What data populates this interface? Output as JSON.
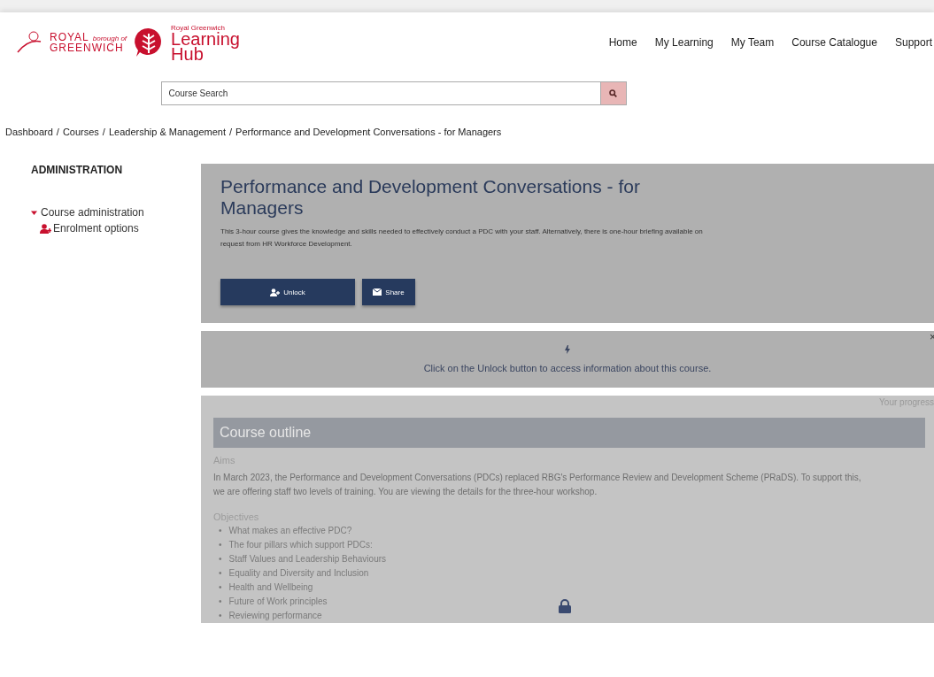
{
  "logo": {
    "council_top": "ROYAL",
    "council_small": "borough of",
    "council_bottom": "GREENWICH",
    "hub_small": "Royal Greenwich",
    "hub_top": "Learning",
    "hub_bottom": "Hub"
  },
  "nav": [
    "Home",
    "My Learning",
    "My Team",
    "Course Catalogue",
    "Support"
  ],
  "search": {
    "placeholder": "Course Search"
  },
  "breadcrumb": [
    {
      "label": "Dashboard"
    },
    {
      "separator": "/",
      "label": "Courses"
    },
    {
      "separator": "/",
      "label": "Leadership & Management"
    },
    {
      "separator": "/",
      "label": "Performance and Development Conversations - for Managers"
    }
  ],
  "sidebar": {
    "title": "ADMINISTRATION",
    "items": [
      {
        "label": "Course administration",
        "expanded": true,
        "children": [
          {
            "label": "Enrolment options"
          }
        ]
      }
    ]
  },
  "course": {
    "title": "Performance and Development Conversations - for Managers",
    "summary": "This 3-hour course gives the knowledge and skills needed to effectively conduct a PDC with your staff. Alternatively, there is one-hour briefing available on request from HR Workforce Development.",
    "buttons": [
      {
        "label": "Unlock",
        "kind": "unlock"
      },
      {
        "label": "Share",
        "kind": "share"
      }
    ]
  },
  "notice": {
    "text": "Click on the Unlock button to access information about this course.",
    "close": "×"
  },
  "content": {
    "progress": "Your progress",
    "section": "Course outline",
    "aims_heading": "Aims",
    "aims": "In March 2023, the Performance and Development Conversations (PDCs) replaced RBG's Performance Review and Development Scheme (PRaDS).  To support this, we are offering staff two levels of training.  You are viewing the details for the three-hour workshop.",
    "objectives_heading": "Objectives",
    "objectives": [
      {
        "bullet": "•",
        "text": "What makes an effective PDC?"
      },
      {
        "bullet": "•",
        "text": "The four pillars which support PDCs:"
      },
      {
        "bullet": "•",
        "text": "Staff Values and Leadership Behaviours"
      },
      {
        "bullet": "•",
        "text": "Equality and Diversity and Inclusion"
      },
      {
        "bullet": "•",
        "text": "Health and Wellbeing"
      },
      {
        "bullet": "•",
        "text": "Future of Work principles"
      },
      {
        "bullet": "•",
        "text": "Reviewing performance"
      }
    ]
  }
}
